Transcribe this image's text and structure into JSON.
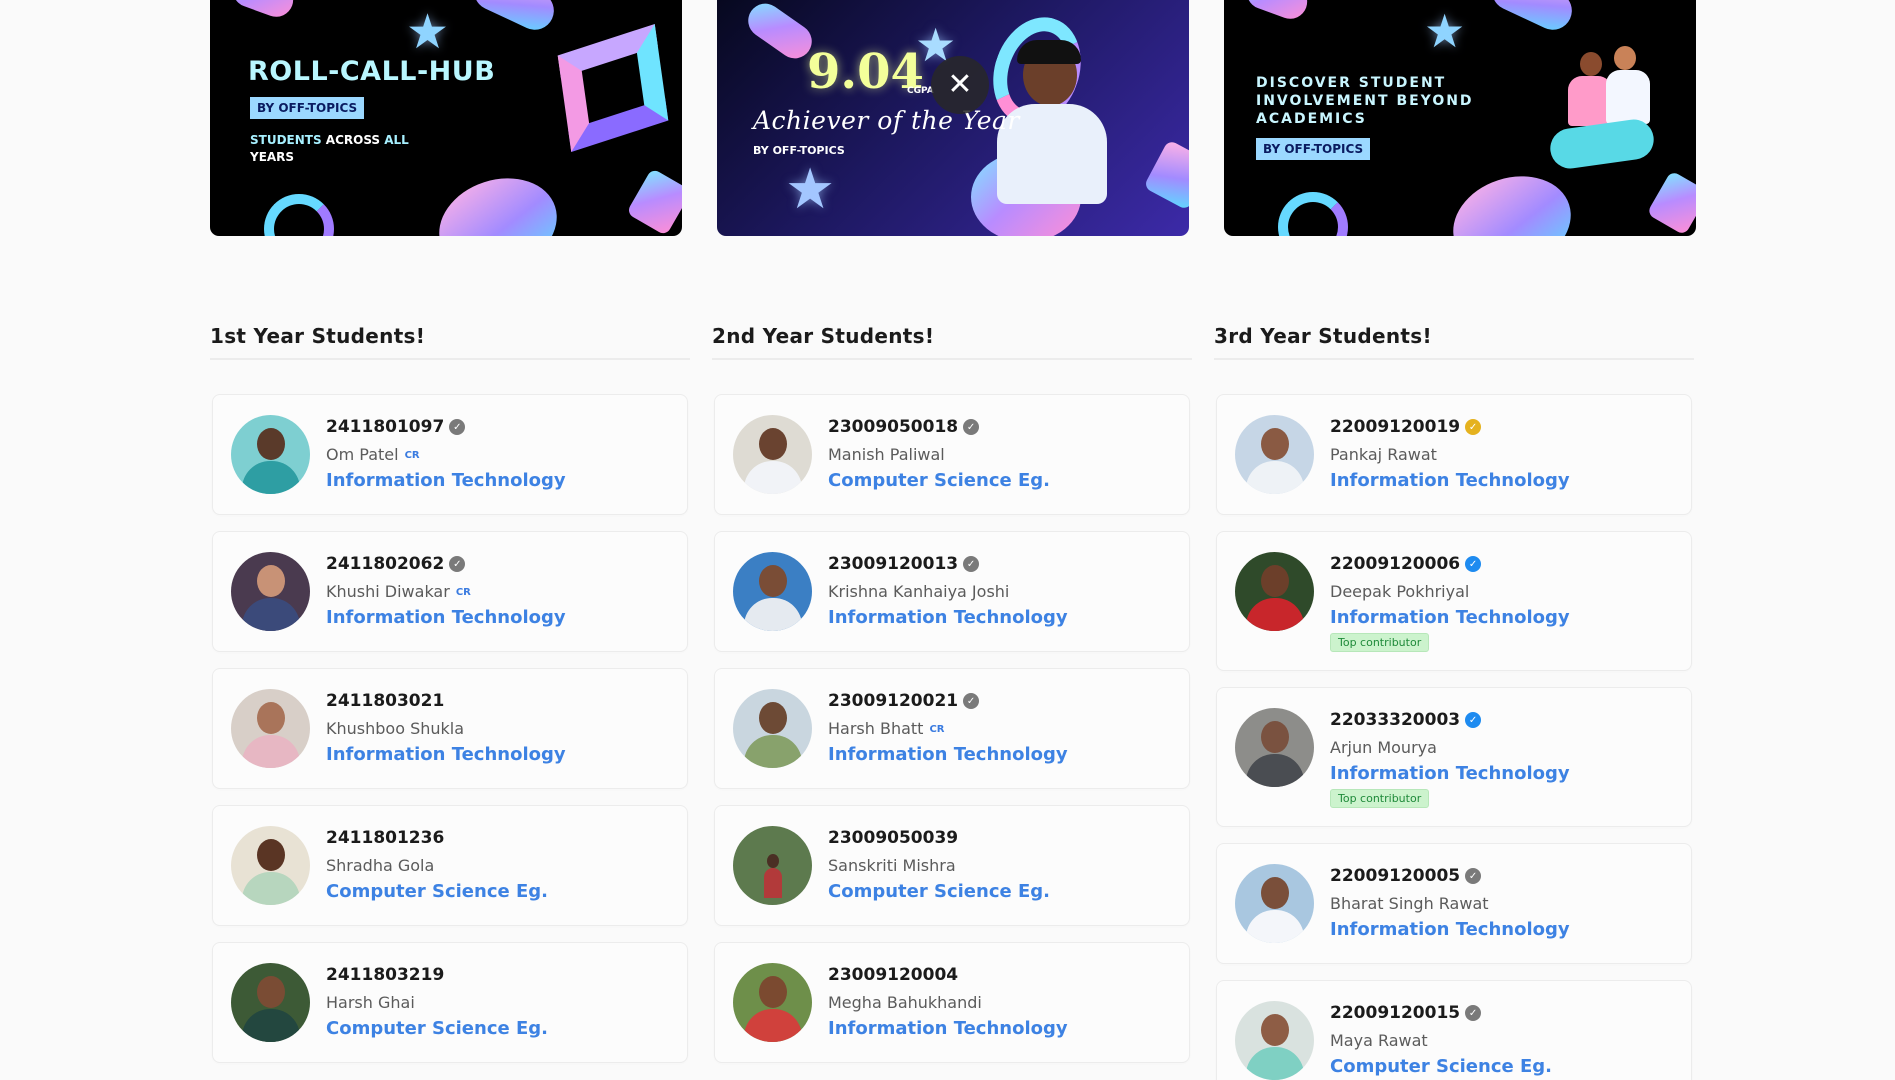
{
  "banners": {
    "b1": {
      "title": "ROLL-CALL-HUB",
      "chip": "BY OFF-TOPICS",
      "tag_students": "STUDENTS",
      "tag_across": " ACROSS ",
      "tag_all": "ALL",
      "tag_years": "YEARS"
    },
    "b2": {
      "cgpa_value": "9.04",
      "cgpa_label": "CGPA",
      "headline": "Achiever of the Year",
      "byline": "BY OFF-TOPICS"
    },
    "b3": {
      "line1": "DISCOVER STUDENT",
      "line2": "INVOLVEMENT BEYOND",
      "line3": "ACADEMICS",
      "chip": "BY OFF-TOPICS"
    },
    "close_label": "✕"
  },
  "columns": [
    {
      "title": "1st Year Students!",
      "students": [
        {
          "roll": "2411801097",
          "badge": "gray",
          "name": "Om Patel",
          "cr": "CR",
          "dept": "Information Technology",
          "tag": ""
        },
        {
          "roll": "2411802062",
          "badge": "gray",
          "name": "Khushi Diwakar",
          "cr": "CR",
          "dept": "Information Technology",
          "tag": ""
        },
        {
          "roll": "2411803021",
          "badge": "",
          "name": "Khushboo Shukla",
          "cr": "",
          "dept": "Information Technology",
          "tag": ""
        },
        {
          "roll": "2411801236",
          "badge": "",
          "name": "Shradha Gola",
          "cr": "",
          "dept": "Computer Science Eg.",
          "tag": ""
        },
        {
          "roll": "2411803219",
          "badge": "",
          "name": "Harsh Ghai",
          "cr": "",
          "dept": "Computer Science Eg.",
          "tag": ""
        }
      ]
    },
    {
      "title": "2nd Year Students!",
      "students": [
        {
          "roll": "23009050018",
          "badge": "gray",
          "name": "Manish Paliwal",
          "cr": "",
          "dept": "Computer Science Eg.",
          "tag": ""
        },
        {
          "roll": "23009120013",
          "badge": "gray",
          "name": "Krishna Kanhaiya Joshi",
          "cr": "",
          "dept": "Information Technology",
          "tag": ""
        },
        {
          "roll": "23009120021",
          "badge": "gray",
          "name": "Harsh Bhatt",
          "cr": "CR",
          "dept": "Information Technology",
          "tag": ""
        },
        {
          "roll": "23009050039",
          "badge": "",
          "name": "Sanskriti Mishra",
          "cr": "",
          "dept": "Computer Science Eg.",
          "tag": ""
        },
        {
          "roll": "23009120004",
          "badge": "",
          "name": "Megha Bahukhandi",
          "cr": "",
          "dept": "Information Technology",
          "tag": ""
        }
      ]
    },
    {
      "title": "3rd Year Students!",
      "students": [
        {
          "roll": "22009120019",
          "badge": "gold",
          "name": "Pankaj Rawat",
          "cr": "",
          "dept": "Information Technology",
          "tag": ""
        },
        {
          "roll": "22009120006",
          "badge": "blue",
          "name": "Deepak Pokhriyal",
          "cr": "",
          "dept": "Information Technology",
          "tag": "Top contributor"
        },
        {
          "roll": "22033320003",
          "badge": "blue",
          "name": "Arjun Mourya",
          "cr": "",
          "dept": "Information Technology",
          "tag": "Top contributor"
        },
        {
          "roll": "22009120005",
          "badge": "gray",
          "name": "Bharat Singh Rawat",
          "cr": "",
          "dept": "Information Technology",
          "tag": ""
        },
        {
          "roll": "22009120015",
          "badge": "gray",
          "name": "Maya Rawat",
          "cr": "",
          "dept": "Computer Science Eg.",
          "tag": ""
        }
      ]
    }
  ],
  "colors": {
    "dept_link": "#3d82e3",
    "cr_label": "#3a7be0",
    "badge_gray": "#7a7a7a",
    "badge_blue": "#1e8bf0",
    "badge_gold": "#e5b21f",
    "tag_bg": "#ccf3cd"
  }
}
